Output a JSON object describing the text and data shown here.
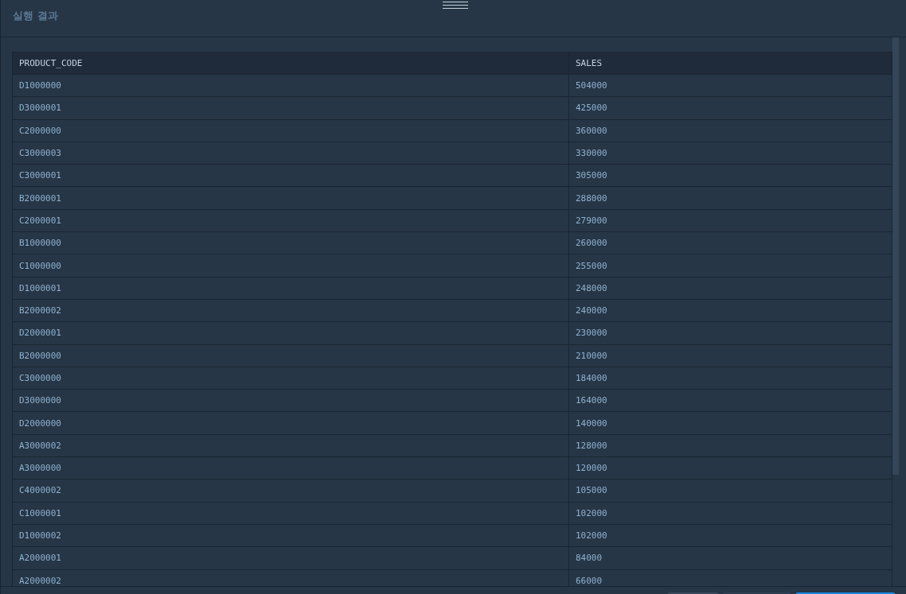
{
  "panel": {
    "title": "실행 결과"
  },
  "table": {
    "columns": [
      "PRODUCT_CODE",
      "SALES"
    ],
    "rows": [
      [
        "D1000000",
        "504000"
      ],
      [
        "D3000001",
        "425000"
      ],
      [
        "C2000000",
        "360000"
      ],
      [
        "C3000003",
        "330000"
      ],
      [
        "C3000001",
        "305000"
      ],
      [
        "B2000001",
        "288000"
      ],
      [
        "C2000001",
        "279000"
      ],
      [
        "B1000000",
        "260000"
      ],
      [
        "C1000000",
        "255000"
      ],
      [
        "D1000001",
        "248000"
      ],
      [
        "B2000002",
        "240000"
      ],
      [
        "D2000001",
        "230000"
      ],
      [
        "B2000000",
        "210000"
      ],
      [
        "C3000000",
        "184000"
      ],
      [
        "D3000000",
        "164000"
      ],
      [
        "D2000000",
        "140000"
      ],
      [
        "A3000002",
        "128000"
      ],
      [
        "A3000000",
        "120000"
      ],
      [
        "C4000002",
        "105000"
      ],
      [
        "C1000001",
        "102000"
      ],
      [
        "D1000002",
        "102000"
      ],
      [
        "A2000001",
        "84000"
      ],
      [
        "A2000002",
        "66000"
      ]
    ]
  }
}
